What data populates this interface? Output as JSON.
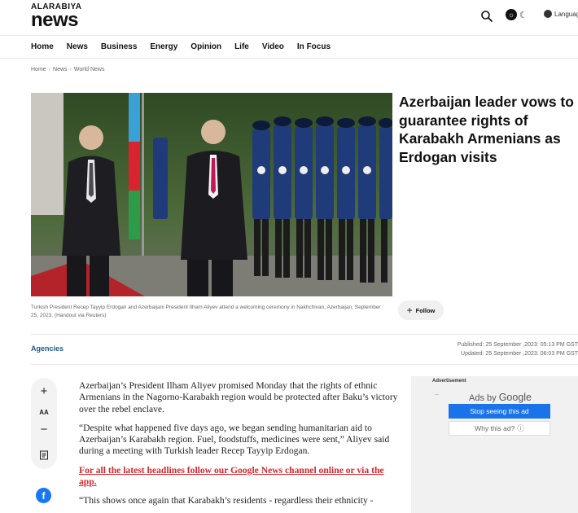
{
  "header": {
    "logo_small": "ALARABIYA",
    "logo_big": "news",
    "language_label": "Language"
  },
  "nav": {
    "items": [
      "Home",
      "News",
      "Business",
      "Energy",
      "Opinion",
      "Life",
      "Video",
      "In Focus"
    ]
  },
  "breadcrumb": [
    "Home",
    "News",
    "World News"
  ],
  "article": {
    "headline": "Azerbaijan leader vows to guarantee rights of Karabakh Armenians as Erdogan visits",
    "caption": "Turkish President Recep Tayyip Erdogan and Azerbaijani President Ilham Aliyev attend a welcoming ceremony in Nakhchivan, Azerbaijan, September 25, 2023. (Handout via Reuters)",
    "follow_label": "Follow",
    "source": "Agencies",
    "published": "Published: 25 September ,2023: 05:13 PM GST",
    "updated": "Updated: 25 September ,2023: 06:03 PM GST",
    "paragraphs": [
      "Azerbaijan’s President Ilham Aliyev promised Monday that the rights of ethnic Armenians in the Nagorno-Karabakh region would be protected after Baku’s victory over the rebel enclave.",
      "“Despite what happened five days ago, we began sending humanitarian aid to Azerbaijan’s Karabakh region. Fuel, foodstuffs, medicines were sent,” Aliyev said during a meeting with Turkish leader Recep Tayyip Erdogan.",
      "“This shows once again that Karabakh’s residents - regardless their ethnicity -"
    ],
    "promo_link": "For all the latest headlines follow our Google News channel online or via the app."
  },
  "rail": {
    "text_size_label": "AA"
  },
  "ad": {
    "label": "Advertisement",
    "ads_by": "Ads by",
    "google": "Google",
    "stop_label": "Stop seeing this ad",
    "why_label": "Why this ad?"
  },
  "colors": {
    "source_blue": "#1e5a87",
    "link_red": "#d7262c",
    "ad_button_blue": "#1a73e8",
    "facebook_blue": "#1877f2"
  }
}
